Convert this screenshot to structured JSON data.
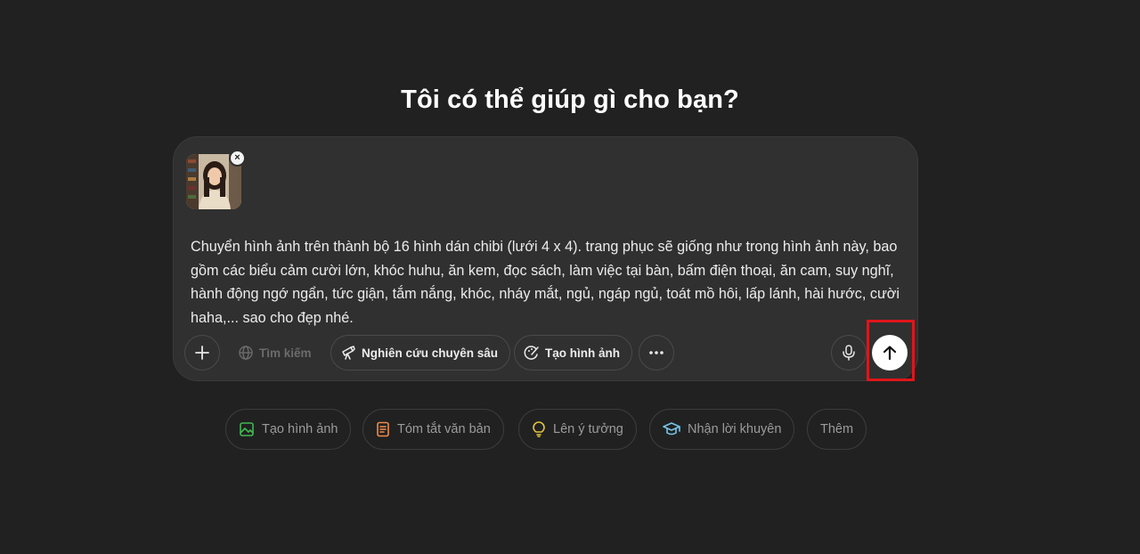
{
  "heading": "Tôi có thể giúp gì cho bạn?",
  "composer": {
    "attachment": {
      "remove_label": "×"
    },
    "prompt_text": "Chuyển hình ảnh trên thành bộ 16 hình dán chibi (lưới 4 x 4). trang phục sẽ giống như trong hình ảnh này, bao gồm các biểu cảm cười lớn, khóc huhu, ăn kem, đọc sách, làm việc tại bàn, bấm điện thoại, ăn cam, suy nghĩ, hành động ngớ ngẩn, tức giận, tắm nắng, khóc, nháy mắt, ngủ, ngáp ngủ, toát mồ hôi, lấp lánh, hài hước, cười haha,... sao cho đẹp nhé.",
    "toolbar": {
      "attach_icon": "plus-icon",
      "search_label": "Tìm kiếm",
      "deep_research_label": "Nghiên cứu chuyên sâu",
      "create_image_label": "Tạo hình ảnh",
      "more_icon": "ellipsis-icon",
      "voice_icon": "microphone-icon",
      "send_icon": "arrow-up-icon"
    }
  },
  "suggestions": [
    {
      "label": "Tạo hình ảnh",
      "icon": "image-icon",
      "color": "#3fb950"
    },
    {
      "label": "Tóm tắt văn bản",
      "icon": "document-icon",
      "color": "#f08a4b"
    },
    {
      "label": "Lên ý tưởng",
      "icon": "lightbulb-icon",
      "color": "#e2c541"
    },
    {
      "label": "Nhận lời khuyên",
      "icon": "graduation-cap-icon",
      "color": "#76c7e8"
    },
    {
      "label": "Thêm",
      "icon": "",
      "color": ""
    }
  ],
  "colors": {
    "background": "#212121",
    "composer": "#303030",
    "highlight": "#e0151a"
  }
}
